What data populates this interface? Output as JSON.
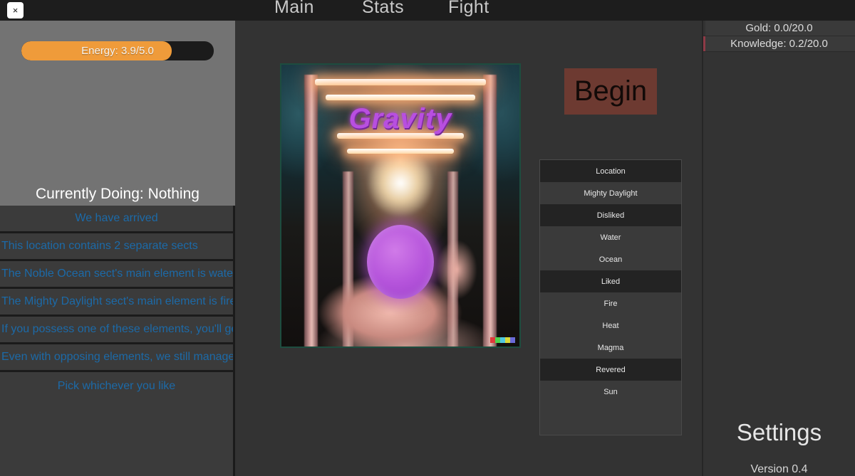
{
  "window": {
    "close_label": "×"
  },
  "nav": {
    "tabs": [
      {
        "label": "Main"
      },
      {
        "label": "Stats"
      },
      {
        "label": "Fight"
      }
    ]
  },
  "left_panel": {
    "energy": {
      "label": "Energy: 3.9/5.0",
      "current": 3.9,
      "max": 5.0,
      "percent": 78,
      "fill_color": "#ef9b3a",
      "track_color": "#1b1b1b"
    },
    "currently_doing": "Currently Doing: Nothing",
    "log_color": "#1c6aa8",
    "log": [
      {
        "text": "We have arrived",
        "align": "center"
      },
      {
        "text": "This location contains 2 separate sects",
        "align": "left"
      },
      {
        "text": "The Noble Ocean sect's main element is water",
        "align": "left"
      },
      {
        "text": "The Mighty Daylight sect's main element is fire",
        "align": "left"
      },
      {
        "text": "If you possess one of these elements, you'll get bonuses",
        "align": "left"
      },
      {
        "text": "Even with opposing elements, we still manage",
        "align": "left"
      },
      {
        "text": "Pick whichever you like",
        "align": "center"
      }
    ]
  },
  "main": {
    "artwork": {
      "title": "Gravity",
      "title_color": "#b84fe0",
      "orb_color": "#b554db",
      "border_color": "#1d4d3f",
      "color_chips": [
        "#e03a3a",
        "#4fd14f",
        "#4fc7e0",
        "#d9d93a",
        "#6a6ad9"
      ]
    },
    "begin_button": {
      "label": "Begin",
      "background": "#6d3a31"
    },
    "info_table": {
      "rows": [
        {
          "label": "Location",
          "type": "header"
        },
        {
          "label": "Mighty Daylight",
          "type": "item"
        },
        {
          "label": "Disliked",
          "type": "header"
        },
        {
          "label": "Water",
          "type": "item"
        },
        {
          "label": "Ocean",
          "type": "item"
        },
        {
          "label": "Liked",
          "type": "header"
        },
        {
          "label": "Fire",
          "type": "item"
        },
        {
          "label": "Heat",
          "type": "item"
        },
        {
          "label": "Magma",
          "type": "item"
        },
        {
          "label": "Revered",
          "type": "header"
        },
        {
          "label": "Sun",
          "type": "item"
        }
      ]
    }
  },
  "right_panel": {
    "stats": [
      {
        "label": "Gold: 0.0/20.0",
        "accent": "#333333"
      },
      {
        "label": "Knowledge: 0.2/20.0",
        "accent": "#8e3a46"
      }
    ],
    "settings_title": "Settings",
    "version": "Version 0.4"
  }
}
